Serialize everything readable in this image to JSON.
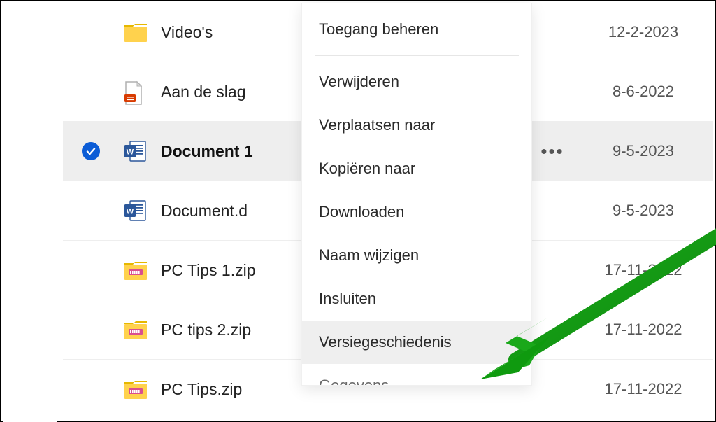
{
  "rows": [
    {
      "name": "Video's",
      "date": "12-2-2023",
      "type": "folder",
      "selected": false
    },
    {
      "name": "Aan de slag",
      "date": "8-6-2022",
      "type": "pdf",
      "selected": false
    },
    {
      "name": "Document 1",
      "date": "9-5-2023",
      "type": "word",
      "selected": true
    },
    {
      "name": "Document.d",
      "date": "9-5-2023",
      "type": "word",
      "selected": false
    },
    {
      "name": "PC Tips 1.zip",
      "date": "17-11-2022",
      "type": "zip",
      "selected": false
    },
    {
      "name": "PC tips 2.zip",
      "date": "17-11-2022",
      "type": "zip",
      "selected": false
    },
    {
      "name": "PC Tips.zip",
      "date": "17-11-2022",
      "type": "zip",
      "selected": false
    }
  ],
  "ellipsis": "•••",
  "menu": {
    "manage_access": "Toegang beheren",
    "delete": "Verwijderen",
    "move_to": "Verplaatsen naar",
    "copy_to": "Kopiëren naar",
    "download": "Downloaden",
    "rename": "Naam wijzigen",
    "embed": "Insluiten",
    "version_history": "Versiegeschiedenis",
    "details": "Gegevens"
  },
  "colors": {
    "selection_blue": "#0b5cd6",
    "arrow_green": "#1aa81a"
  }
}
